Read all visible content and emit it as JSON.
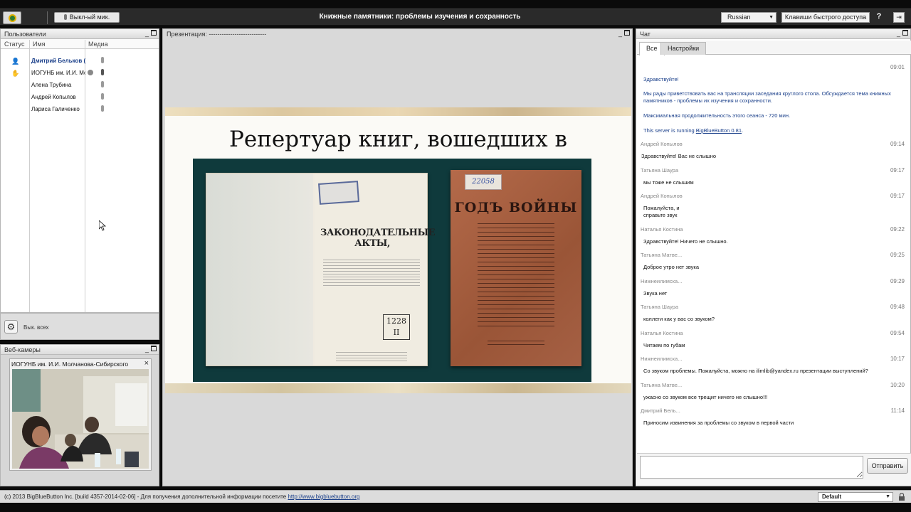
{
  "topbar": {
    "mic_label": "Выкл-ый мик.",
    "title": "Книжные памятники: проблемы изучения и сохранность",
    "language": "Russian",
    "shortcuts_label": "Клавиши быстрого доступа",
    "help_label": "?"
  },
  "users": {
    "title": "Пользователи",
    "columns": {
      "status": "Статус",
      "name": "Имя",
      "media": "Медиа"
    },
    "rows": [
      {
        "name": "Дмитрий Бельков (в"
      },
      {
        "name": "ИОГУНБ им. И.И. Мол"
      },
      {
        "name": "Алена Трубина"
      },
      {
        "name": "Андрей Копылов"
      },
      {
        "name": "Лариса Галиченко"
      }
    ],
    "mute_all": "Вык. всех"
  },
  "webcams": {
    "title": "Веб-камеры",
    "stream_title": "ИОГУНБ им. И.И. Молчанова-Сибирского",
    "close_label": "×"
  },
  "presentation": {
    "title": "Презентация: ---------------------------",
    "slide_title": "Репертуар книг, вошедших в коллекцию",
    "book1_title": "ЗАКОНОДАТЕЛЬНЫЕ АКТЫ,",
    "book1_number": "1228",
    "book1_number2": "II",
    "book2_title": "ГОДЪ ВОЙНЫ",
    "book2_label": "22058"
  },
  "chat": {
    "title": "Чат",
    "tabs": [
      "Все",
      "Настройки"
    ],
    "messages": [
      {
        "sender": "",
        "time": "09:01",
        "lines": []
      },
      {
        "sender": "",
        "time": "",
        "lines": [
          "Здравствуйте!"
        ],
        "system": true
      },
      {
        "sender": "",
        "time": "",
        "lines": [
          "Мы рады приветствовать вас на трансляции заседания круглого стола. Обсуждается тема книжных",
          "памятников - проблемы их изучения и сохранности."
        ],
        "system": true
      },
      {
        "sender": "",
        "time": "",
        "lines": [
          "Максимальная продолжительность этого сеанса - 720 мин."
        ],
        "system": true
      },
      {
        "sender": "",
        "time": "",
        "lines": [
          "This server is running "
        ],
        "link": "BigBlueButton 0.81",
        "system": true
      },
      {
        "sender": "Андрей Копылов",
        "time": "09:14",
        "lines": [
          "Здравствуйте! Вас не слышно"
        ]
      },
      {
        "sender": "Татьяна Шаура",
        "time": "09:17",
        "lines": [
          "мы тоже не слышим"
        ]
      },
      {
        "sender": "Андрей Копылов",
        "time": "09:17",
        "lines": [
          "Пожалуйста, и",
          "справьте звук"
        ]
      },
      {
        "sender": "Наталья Костина",
        "time": "09:22",
        "lines": [
          "Здравствуйте! Ничего не слышно."
        ]
      },
      {
        "sender": "Татьяна Матве...",
        "time": "09:25",
        "lines": [
          "Доброе утро нет звука"
        ]
      },
      {
        "sender": "Нижнеилимска...",
        "time": "09:29",
        "lines": [
          "Звука нет"
        ]
      },
      {
        "sender": "Татьяна Шаура",
        "time": "09:48",
        "lines": [
          "коллеги как у вас со звуком?"
        ]
      },
      {
        "sender": "Наталья Костина",
        "time": "09:54",
        "lines": [
          "Читаем по губам"
        ]
      },
      {
        "sender": "Нижнеилимска...",
        "time": "10:17",
        "lines": [
          "Со звуком проблемы. Пожалуйста, можно на ilimlib@yandex.ru презентации выступлений?"
        ]
      },
      {
        "sender": "Татьяна Матве...",
        "time": "10:20",
        "lines": [
          "ужасно со звуком все трещит ничего не слышно!!!"
        ]
      },
      {
        "sender": "Дмитрий Бель...",
        "time": "11:14",
        "lines": [
          "Приносим извинения за проблемы со звуком в первой части"
        ]
      }
    ],
    "send_label": "Отправить",
    "input_value": ""
  },
  "footer": {
    "copyright": "(c) 2013 BigBlueButton Inc. [build 4357-2014-02-06] - Для получения дополнительной информации посетите ",
    "link": "http://www.bigbluebutton.org",
    "layout": "Default"
  },
  "colors": {
    "topbar_bg": "#2a2a2a",
    "link": "#1a3f8a",
    "slide_photo_bg": "#0f3a3c"
  }
}
